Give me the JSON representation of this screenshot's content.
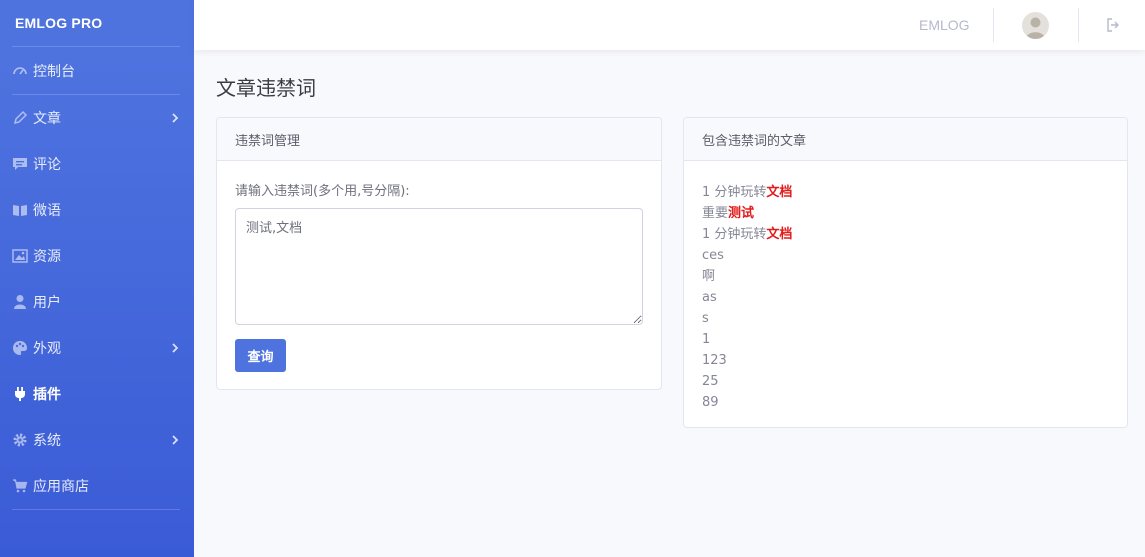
{
  "sidebar": {
    "brand": "EMLOG PRO",
    "items": [
      {
        "label": "控制台",
        "icon": "dashboard-icon",
        "has_children": false,
        "active": false
      },
      {
        "label": "文章",
        "icon": "pencil-icon",
        "has_children": true,
        "active": false
      },
      {
        "label": "评论",
        "icon": "comment-icon",
        "has_children": false,
        "active": false
      },
      {
        "label": "微语",
        "icon": "book-icon",
        "has_children": false,
        "active": false
      },
      {
        "label": "资源",
        "icon": "image-icon",
        "has_children": false,
        "active": false
      },
      {
        "label": "用户",
        "icon": "user-icon",
        "has_children": false,
        "active": false
      },
      {
        "label": "外观",
        "icon": "palette-icon",
        "has_children": true,
        "active": false
      },
      {
        "label": "插件",
        "icon": "plug-icon",
        "has_children": false,
        "active": true
      },
      {
        "label": "系统",
        "icon": "gear-icon",
        "has_children": true,
        "active": false
      },
      {
        "label": "应用商店",
        "icon": "cart-icon",
        "has_children": false,
        "active": false
      }
    ]
  },
  "topbar": {
    "user_name": "EMLOG"
  },
  "page": {
    "title": "文章违禁词"
  },
  "manage_card": {
    "header": "违禁词管理",
    "input_label": "请输入违禁词(多个用,号分隔):",
    "input_value": "测试,文档",
    "submit_label": "查询"
  },
  "articles_card": {
    "header": "包含违禁词的文章",
    "articles": [
      {
        "text": "1 分钟玩转",
        "highlight": "文档"
      },
      {
        "text": "重要",
        "highlight": "测试"
      },
      {
        "text": "1 分钟玩转",
        "highlight": "文档"
      },
      {
        "text": "ces",
        "highlight": ""
      },
      {
        "text": "啊",
        "highlight": ""
      },
      {
        "text": "as",
        "highlight": ""
      },
      {
        "text": "s",
        "highlight": ""
      },
      {
        "text": "1",
        "highlight": ""
      },
      {
        "text": "123",
        "highlight": ""
      },
      {
        "text": "25",
        "highlight": ""
      },
      {
        "text": "89",
        "highlight": ""
      }
    ]
  },
  "colors": {
    "primary": "#4e73df",
    "highlight": "#e21b1b"
  }
}
